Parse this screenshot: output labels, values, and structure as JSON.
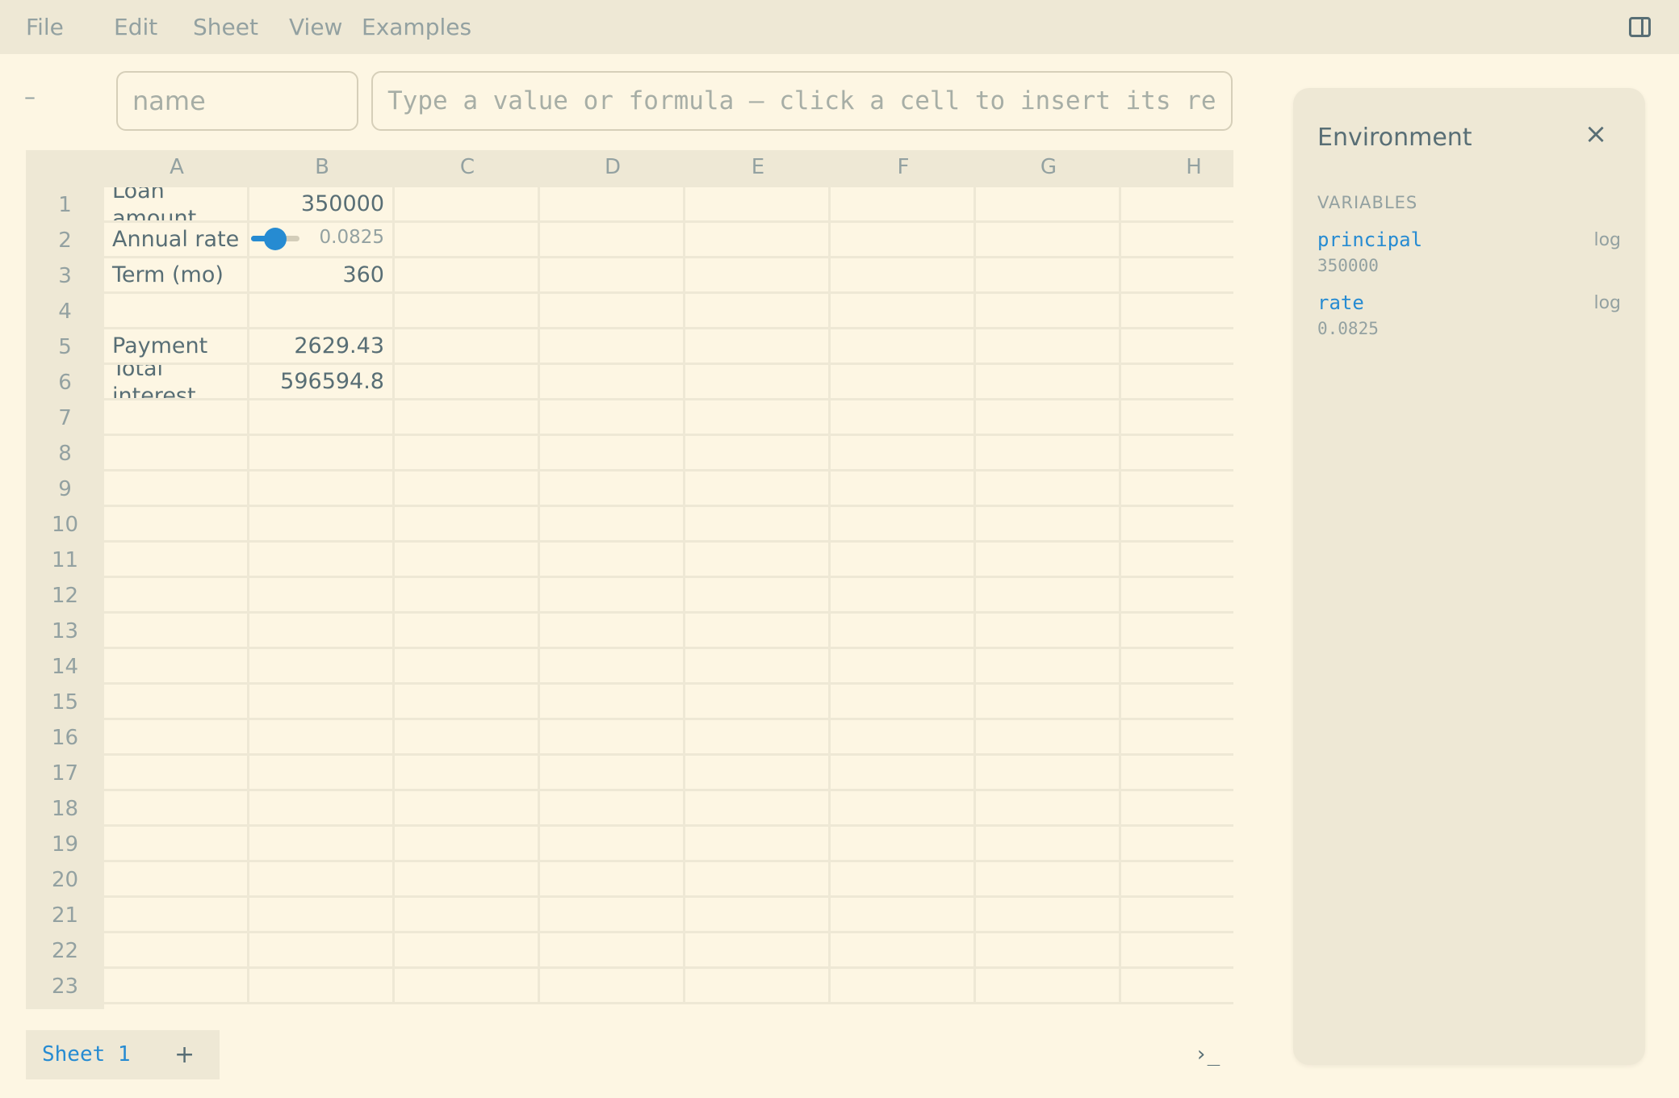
{
  "menu": {
    "file": "File",
    "edit": "Edit",
    "sheet": "Sheet",
    "view": "View",
    "examples": "Examples"
  },
  "formula_bar": {
    "cell_ref": "–",
    "name_placeholder": "name",
    "formula_placeholder": "Type a value or formula — click a cell to insert its ref"
  },
  "grid": {
    "columns": [
      "A",
      "B",
      "C",
      "D",
      "E",
      "F",
      "G",
      "H"
    ],
    "rows": [
      "1",
      "2",
      "3",
      "4",
      "5",
      "6",
      "7",
      "8",
      "9",
      "10",
      "11",
      "12",
      "13",
      "14",
      "15",
      "16",
      "17",
      "18",
      "19",
      "20",
      "21",
      "22",
      "23"
    ],
    "cells": {
      "A1": "Loan amount",
      "B1": "350000",
      "A2": "Annual rate",
      "B2": "0.0825",
      "A3": "Term (mo)",
      "B3": "360",
      "A5": "Payment",
      "B5": "2629.43",
      "A6": "Total interest",
      "B6": "596594.8"
    },
    "rate_slider_fraction": 0.5
  },
  "sheets": {
    "tabs": [
      "Sheet 1"
    ],
    "add_label": "+"
  },
  "console": {
    "icon": "terminal-icon",
    "glyph": "›_"
  },
  "environment": {
    "title": "Environment",
    "close_glyph": "×",
    "section": "VARIABLES",
    "variables": [
      {
        "name": "principal",
        "value": "350000",
        "action": "log"
      },
      {
        "name": "rate",
        "value": "0.0825",
        "action": "log"
      }
    ]
  },
  "colors": {
    "background": "#fdf6e3",
    "chrome": "#eee8d5",
    "accent": "#268bd2",
    "text": "#586e75",
    "muted": "#93a1a1"
  }
}
